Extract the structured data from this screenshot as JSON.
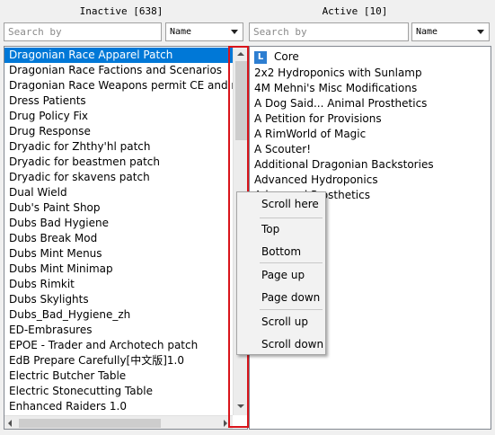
{
  "inactive": {
    "title": "Inactive [638]",
    "search_placeholder": "Search by",
    "sort_value": "Name",
    "items": [
      "Dragonian Race Apparel Patch",
      "Dragonian Race Factions and Scenarios",
      "Dragonian Race Weapons permit CE and m",
      "Dress Patients",
      "Drug Policy Fix",
      "Drug Response",
      "Dryadic for Zhthy'hl patch",
      "Dryadic for beastmen patch",
      "Dryadic for skavens patch",
      "Dual Wield",
      "Dub's Paint Shop",
      "Dubs Bad Hygiene",
      "Dubs Break Mod",
      "Dubs Mint Menus",
      "Dubs Mint Minimap",
      "Dubs Rimkit",
      "Dubs Skylights",
      "Dubs_Bad_Hygiene_zh",
      "ED-Embrasures",
      "EPOE - Trader and Archotech patch",
      "EdB Prepare Carefully[中文版]1.0",
      "Electric Butcher Table",
      "Electric Stonecutting Table",
      "Enhanced Raiders 1.0"
    ]
  },
  "active": {
    "title": "Active [10]",
    "search_placeholder": "Search by",
    "sort_value": "Name",
    "core_badge": "L",
    "items": [
      "Core",
      "2x2 Hydroponics with Sunlamp",
      "4M Mehni's Misc Modifications",
      "A Dog Said... Animal Prosthetics",
      "A Petition for Provisions",
      "A RimWorld of Magic",
      "A Scouter!",
      "Additional Dragonian Backstories",
      "Advanced Hydroponics",
      "Advanced Prosthetics"
    ]
  },
  "context_menu": {
    "scroll_here": "Scroll here",
    "top": "Top",
    "bottom": "Bottom",
    "page_up": "Page up",
    "page_down": "Page down",
    "scroll_up": "Scroll up",
    "scroll_down": "Scroll down"
  },
  "colors": {
    "selection": "#0078d7",
    "highlight_box": "#d9141b",
    "core_badge": "#2d7ed1"
  },
  "icons": {
    "sort_dropdown": "chevron-down-icon",
    "scroll_up": "triangle-up-icon",
    "scroll_down": "triangle-down-icon",
    "scroll_left": "triangle-left-icon",
    "scroll_right": "triangle-right-icon"
  }
}
